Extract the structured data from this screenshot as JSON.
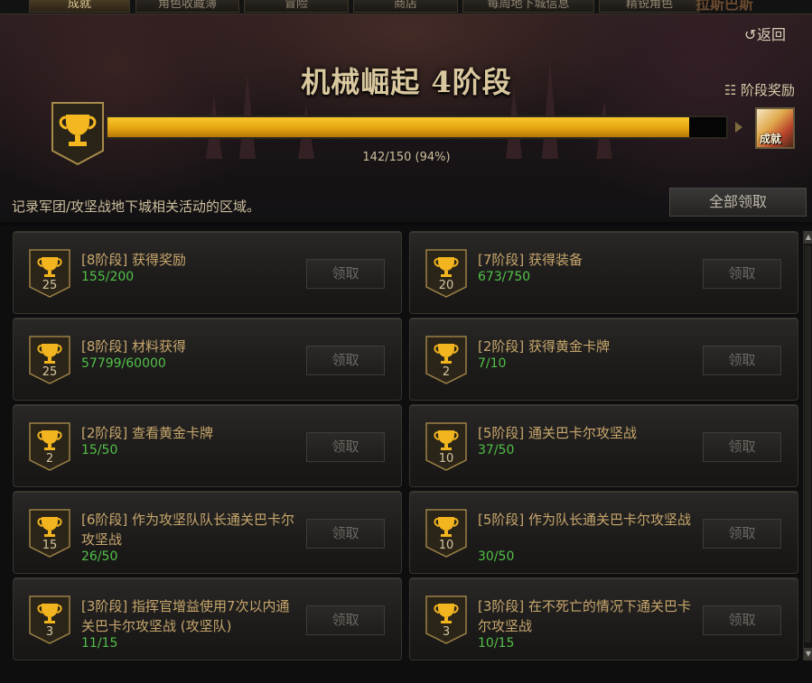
{
  "tabs": [
    {
      "label": "成就",
      "active": true
    },
    {
      "label": "角色收藏簿",
      "active": false
    },
    {
      "label": "冒险",
      "active": false
    },
    {
      "label": "商店",
      "active": false
    },
    {
      "label": "每周地下城信息",
      "active": false
    },
    {
      "label": "精锐角色",
      "active": false
    }
  ],
  "tab_extra": "拉斯巴斯",
  "header": {
    "back_label": "返回",
    "title": "机械崛起 4阶段",
    "stage_reward_label": "阶段奖励",
    "reward_icon_text": "成就",
    "progress_text": "142/150 (94%)",
    "progress_fraction": 0.94
  },
  "description": "记录军团/攻坚战地下城相关活动的区域。",
  "claim_all_label": "全部领取",
  "claim_label": "领取",
  "achievements": [
    {
      "points": "25",
      "title": "[8阶段] 获得奖励",
      "progress": "155/200"
    },
    {
      "points": "20",
      "title": "[7阶段] 获得装备",
      "progress": "673/750"
    },
    {
      "points": "25",
      "title": "[8阶段] 材料获得",
      "progress": "57799/60000"
    },
    {
      "points": "2",
      "title": "[2阶段] 获得黄金卡牌",
      "progress": "7/10"
    },
    {
      "points": "2",
      "title": "[2阶段] 查看黄金卡牌",
      "progress": "15/50"
    },
    {
      "points": "10",
      "title": "[5阶段] 通关巴卡尔攻坚战",
      "progress": "37/50"
    },
    {
      "points": "15",
      "title": "[6阶段] 作为攻坚队队长通关巴卡尔攻坚战",
      "progress": "26/50"
    },
    {
      "points": "10",
      "title": "[5阶段] 作为队长通关巴卡尔攻坚战",
      "progress": "30/50"
    },
    {
      "points": "3",
      "title": "[3阶段] 指挥官增益使用7次以内通关巴卡尔攻坚战 (攻坚队)",
      "progress": "11/15"
    },
    {
      "points": "3",
      "title": "[3阶段] 在不死亡的情况下通关巴卡尔攻坚战",
      "progress": "10/15"
    }
  ],
  "colors": {
    "accent_gold": "#e6a413",
    "progress_green": "#52c048",
    "title_gold": "#c7a66c"
  },
  "icons": {
    "trophy": "trophy-icon",
    "back": "back-arrow-icon",
    "gift": "gift-icon"
  }
}
